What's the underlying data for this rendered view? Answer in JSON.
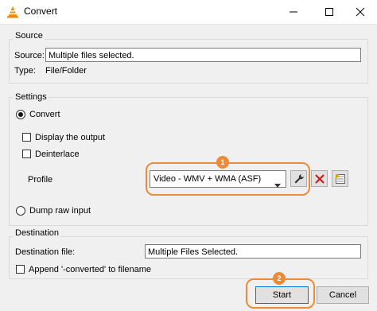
{
  "window": {
    "title": "Convert"
  },
  "source": {
    "group_title": "Source",
    "source_label": "Source:",
    "source_value": "Multiple files selected.",
    "type_label": "Type:",
    "type_value": "File/Folder"
  },
  "settings": {
    "group_title": "Settings",
    "convert_label": "Convert",
    "convert_selected": true,
    "display_output_label": "Display the output",
    "display_output_checked": false,
    "deinterlace_label": "Deinterlace",
    "deinterlace_checked": false,
    "profile_label": "Profile",
    "profile_value": "Video - WMV + WMA (ASF)",
    "dump_raw_label": "Dump raw input",
    "dump_raw_selected": false
  },
  "destination": {
    "group_title": "Destination",
    "file_label": "Destination file:",
    "file_value": "Multiple Files Selected.",
    "append_label": "Append '-converted' to filename",
    "append_checked": false
  },
  "buttons": {
    "start_label": "Start",
    "cancel_label": "Cancel"
  },
  "annotations": {
    "badge_1": "1",
    "badge_2": "2",
    "accent_color": "#ec8b3a"
  },
  "icons": {
    "app": "vlc-cone-icon",
    "edit_profile": "wrench-icon",
    "delete_profile": "red-x-icon",
    "new_profile": "list-icon"
  }
}
